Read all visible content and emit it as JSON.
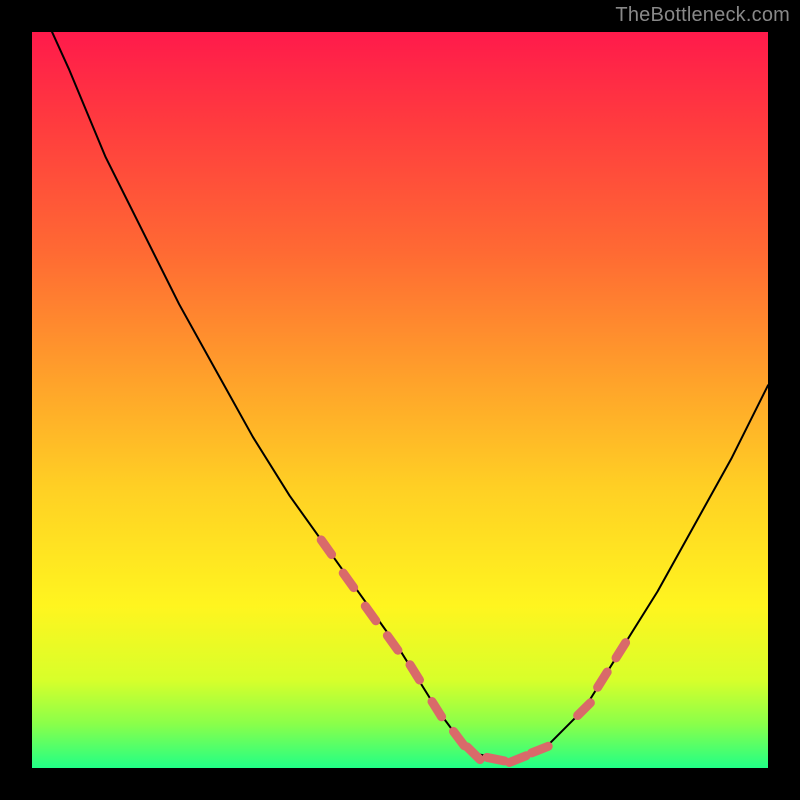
{
  "watermark": "TheBottleneck.com",
  "colors": {
    "frame": "#000000",
    "watermark": "#888888",
    "curve": "#000000",
    "marker": "#d96a6a",
    "gradient_stops": [
      "#ff1a4b",
      "#ff3a3f",
      "#ff6a33",
      "#ffa42a",
      "#ffd024",
      "#fff51f",
      "#d8ff2a",
      "#8aff4a",
      "#21ff86"
    ]
  },
  "chart_data": {
    "type": "line",
    "title": "",
    "xlabel": "",
    "ylabel": "",
    "xlim": [
      0,
      100
    ],
    "ylim": [
      0,
      100
    ],
    "grid": false,
    "legend": false,
    "annotations": [],
    "series": [
      {
        "name": "curve",
        "x": [
          0,
          5,
          10,
          15,
          20,
          25,
          30,
          35,
          40,
          45,
          50,
          55,
          58,
          60,
          65,
          70,
          75,
          80,
          85,
          90,
          95,
          100
        ],
        "y": [
          106,
          95,
          83,
          73,
          63,
          54,
          45,
          37,
          30,
          23,
          16,
          8,
          4,
          2,
          1,
          3,
          8,
          16,
          24,
          33,
          42,
          52
        ]
      }
    ],
    "markers": [
      {
        "name": "dash-segment-left",
        "style": "dash",
        "x": [
          40,
          43,
          46,
          49,
          52,
          55,
          58
        ],
        "y": [
          30,
          25.5,
          21,
          17,
          13,
          8,
          4
        ]
      },
      {
        "name": "dash-segment-bottom",
        "style": "dash",
        "x": [
          60,
          63,
          66,
          69
        ],
        "y": [
          2,
          1.2,
          1.2,
          2.5
        ]
      },
      {
        "name": "dash-segment-right",
        "style": "dash",
        "x": [
          75,
          77.5,
          80
        ],
        "y": [
          8,
          12,
          16
        ]
      }
    ]
  }
}
